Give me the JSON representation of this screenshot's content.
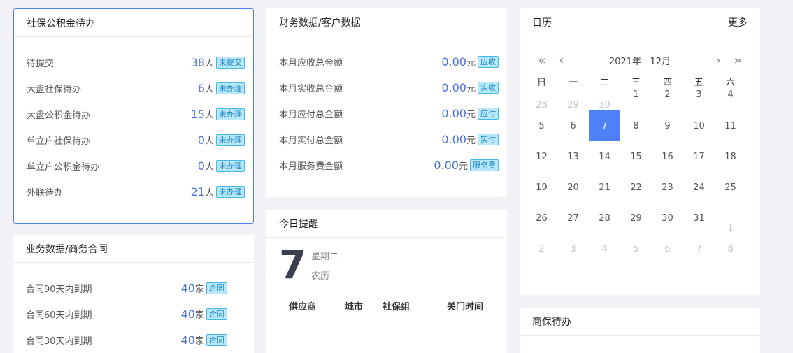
{
  "pending": {
    "title": "社保公积金待办",
    "items": [
      {
        "label": "待提交",
        "count": "38",
        "unit": "人",
        "badge": "未提交"
      },
      {
        "label": "大盘社保待办",
        "count": "6",
        "unit": "人",
        "badge": "未办理"
      },
      {
        "label": "大盘公积金待办",
        "count": "15",
        "unit": "人",
        "badge": "未办理"
      },
      {
        "label": "单立户社保待办",
        "count": "0",
        "unit": "人",
        "badge": "未办理"
      },
      {
        "label": "单立户公积金待办",
        "count": "0",
        "unit": "人",
        "badge": "未办理"
      },
      {
        "label": "外联待办",
        "count": "21",
        "unit": "人",
        "badge": "未办理"
      }
    ]
  },
  "finance": {
    "title": "财务数据/客户数据",
    "items": [
      {
        "label": "本月应收总金额",
        "amount": "0.00",
        "unit": "元",
        "badge": "应收"
      },
      {
        "label": "本月实收总金额",
        "amount": "0.00",
        "unit": "元",
        "badge": "实收"
      },
      {
        "label": "本月应付总金额",
        "amount": "0.00",
        "unit": "元",
        "badge": "应付"
      },
      {
        "label": "本月实付总金额",
        "amount": "0.00",
        "unit": "元",
        "badge": "实付"
      },
      {
        "label": "本月服务费金额",
        "amount": "0.00",
        "unit": "元",
        "badge": "服务费"
      }
    ]
  },
  "calendar": {
    "title": "日历",
    "more": "更多",
    "year_label": "2021年",
    "month_label": "12月",
    "weekdays": [
      "日",
      "一",
      "二",
      "三",
      "四",
      "五",
      "六"
    ],
    "weeks": [
      [
        "28",
        "29",
        "30",
        "1",
        "2",
        "3",
        "4"
      ],
      [
        "5",
        "6",
        "7",
        "8",
        "9",
        "10",
        "11"
      ],
      [
        "12",
        "13",
        "14",
        "15",
        "16",
        "17",
        "18"
      ],
      [
        "19",
        "20",
        "21",
        "22",
        "23",
        "24",
        "25"
      ],
      [
        "26",
        "27",
        "28",
        "29",
        "30",
        "31",
        "1"
      ],
      [
        "2",
        "3",
        "4",
        "5",
        "6",
        "7",
        "8"
      ]
    ],
    "selected_day": "7"
  },
  "business": {
    "title": "业务数据/商务合同",
    "items": [
      {
        "label": "合同90天内到期",
        "count": "40",
        "unit": "家",
        "badge": "合同"
      },
      {
        "label": "合同60天内到期",
        "count": "40",
        "unit": "家",
        "badge": "合同"
      },
      {
        "label": "合同30天内到期",
        "count": "40",
        "unit": "家",
        "badge": "合同"
      }
    ]
  },
  "today": {
    "title": "今日提醒",
    "day": "7",
    "weekday": "星期二",
    "lunar": "农历",
    "columns": [
      "供应商",
      "城市",
      "社保组",
      "关门时间"
    ]
  },
  "insurance": {
    "title": "商保待办"
  },
  "colors": {
    "accent": "#4f80f7",
    "number": "#4a72d8",
    "badge_bg": "#b9e8fb",
    "badge_border": "#44b8ea",
    "page_bg": "#f1f2f6"
  }
}
